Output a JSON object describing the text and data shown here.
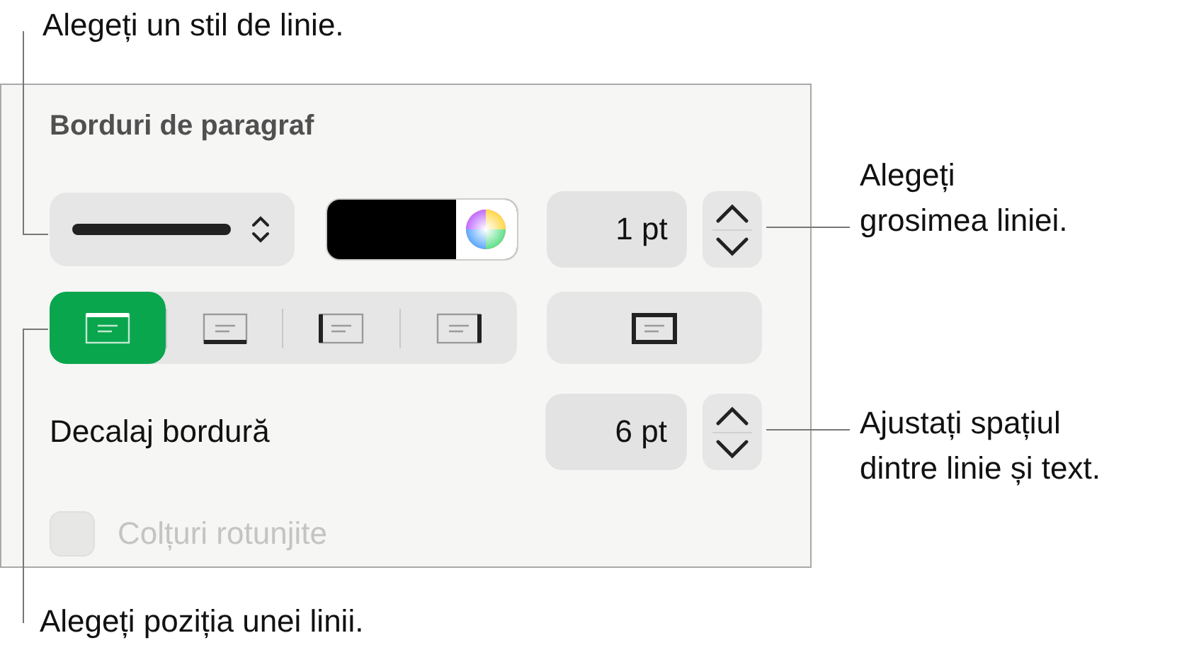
{
  "callouts": [
    {
      "lines": [
        "Alegeți un stil de linie."
      ]
    },
    {
      "lines": [
        "Alegeți",
        "grosimea liniei."
      ]
    },
    {
      "lines": [
        "Ajustați spațiul",
        "dintre linie și text."
      ]
    },
    {
      "lines": [
        "Alegeți poziția unei linii."
      ]
    }
  ],
  "panel": {
    "title": "Borduri de paragraf",
    "line_width": {
      "value": "1 pt"
    },
    "border_positions": [
      {
        "kind": "top",
        "selected": true
      },
      {
        "kind": "bottom",
        "selected": false
      },
      {
        "kind": "left",
        "selected": false
      },
      {
        "kind": "right",
        "selected": false
      }
    ],
    "all_borders": {
      "selected": false
    },
    "offset": {
      "label": "Decalaj bordură",
      "value": "6 pt"
    },
    "rounded_corners": {
      "label": "Colțuri rotunjite",
      "checked": false,
      "disabled": true
    }
  }
}
